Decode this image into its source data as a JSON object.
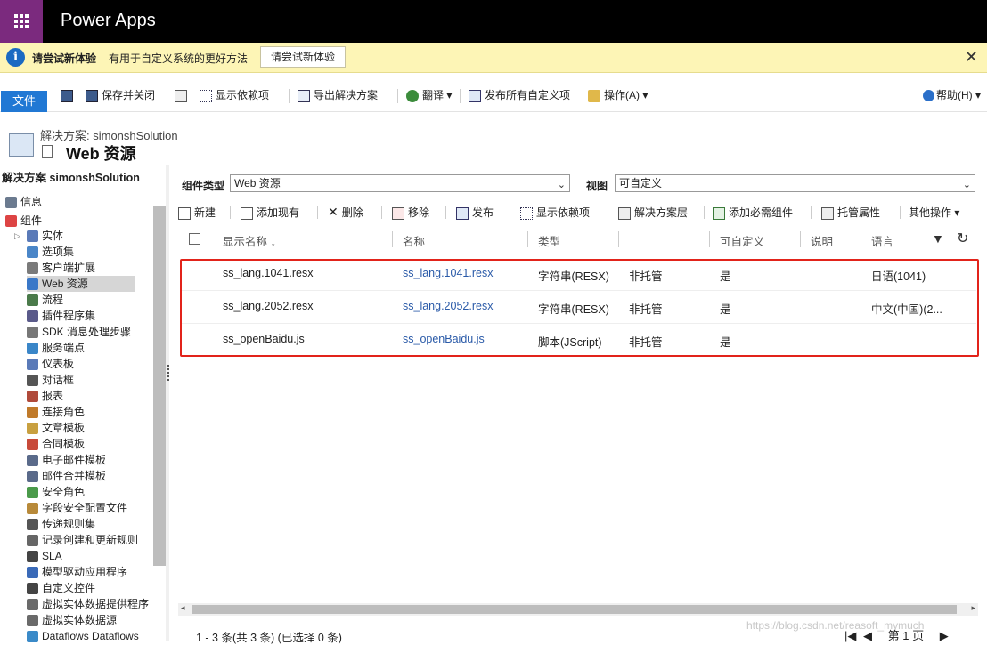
{
  "app": {
    "title": "Power Apps"
  },
  "notice": {
    "title": "请尝试新体验",
    "message": "有用于自定义系统的更好方法",
    "button": "请尝试新体验",
    "close": "✕"
  },
  "commandbar": {
    "file": "文件",
    "save_close": "保存并关闭",
    "show_dependencies": "显示依赖项",
    "export_solution": "导出解决方案",
    "translate": "翻译",
    "publish_all": "发布所有自定义项",
    "actions": "操作(A)",
    "help": "帮助(H)"
  },
  "header": {
    "solution_label": "解决方案: simonshSolution",
    "page_title": "Web 资源"
  },
  "nav": {
    "heading": "解决方案 simonshSolution",
    "items": [
      {
        "label": "信息",
        "icon": "wrench-icon"
      },
      {
        "label": "组件",
        "icon": "components-icon"
      },
      {
        "label": "实体",
        "icon": "entity-icon"
      },
      {
        "label": "选项集",
        "icon": "optionset-icon"
      },
      {
        "label": "客户端扩展",
        "icon": "extension-icon"
      },
      {
        "label": "Web 资源",
        "icon": "webresource-icon"
      },
      {
        "label": "流程",
        "icon": "process-icon"
      },
      {
        "label": "插件程序集",
        "icon": "plugin-icon"
      },
      {
        "label": "SDK 消息处理步骤",
        "icon": "sdk-icon"
      },
      {
        "label": "服务端点",
        "icon": "endpoint-icon"
      },
      {
        "label": "仪表板",
        "icon": "dashboard-icon"
      },
      {
        "label": "对话框",
        "icon": "dialog-icon"
      },
      {
        "label": "报表",
        "icon": "report-icon"
      },
      {
        "label": "连接角色",
        "icon": "connection-role-icon"
      },
      {
        "label": "文章模板",
        "icon": "article-template-icon"
      },
      {
        "label": "合同模板",
        "icon": "contract-template-icon"
      },
      {
        "label": "电子邮件模板",
        "icon": "email-template-icon"
      },
      {
        "label": "邮件合并模板",
        "icon": "mailmerge-template-icon"
      },
      {
        "label": "安全角色",
        "icon": "security-role-icon"
      },
      {
        "label": "字段安全配置文件",
        "icon": "field-security-icon"
      },
      {
        "label": "传递规则集",
        "icon": "routing-rule-icon"
      },
      {
        "label": "记录创建和更新规则",
        "icon": "record-rule-icon"
      },
      {
        "label": "SLA",
        "icon": "sla-icon"
      },
      {
        "label": "模型驱动应用程序",
        "icon": "app-icon"
      },
      {
        "label": "自定义控件",
        "icon": "custom-control-icon"
      },
      {
        "label": "虚拟实体数据提供程序",
        "icon": "data-provider-icon"
      },
      {
        "label": "虚拟实体数据源",
        "icon": "data-source-icon"
      },
      {
        "label": "Dataflows Dataflows",
        "icon": "dataflow-icon"
      }
    ]
  },
  "filters": {
    "component_type_label": "组件类型",
    "component_type_value": "Web 资源",
    "view_label": "视图",
    "view_value": "可自定义"
  },
  "gridbar": {
    "new": "新建",
    "add_existing": "添加现有",
    "delete": "删除",
    "remove": "移除",
    "publish": "发布",
    "show_dependencies": "显示依赖项",
    "solution_layers": "解决方案层",
    "add_required": "添加必需组件",
    "managed_props": "托管属性",
    "more": "其他操作"
  },
  "columns": {
    "display_name": "显示名称 ↓",
    "name": "名称",
    "type": "类型",
    "managed": "",
    "customizable": "可自定义",
    "description": "说明",
    "language": "语言"
  },
  "rows": [
    {
      "display_name": "ss_lang.1041.resx",
      "name": "ss_lang.1041.resx",
      "type": "字符串(RESX)",
      "managed": "非托管",
      "customizable": "是",
      "language": "日语(1041)"
    },
    {
      "display_name": "ss_lang.2052.resx",
      "name": "ss_lang.2052.resx",
      "type": "字符串(RESX)",
      "managed": "非托管",
      "customizable": "是",
      "language": "中文(中国)(2..."
    },
    {
      "display_name": "ss_openBaidu.js",
      "name": "ss_openBaidu.js",
      "type": "脚本(JScript)",
      "managed": "非托管",
      "customizable": "是",
      "language": ""
    }
  ],
  "footer": {
    "summary": "1 - 3  条(共 3 条) (已选择 0 条)",
    "page": "第 1 页",
    "watermark": "https://blog.csdn.net/reasoft_mymuch"
  },
  "colors": {
    "accent": "#2178d4",
    "waffle": "#7b2a7e",
    "notice_bg": "#fdf5b6",
    "highlight": "#e2231a",
    "link": "#2a5aa8"
  }
}
